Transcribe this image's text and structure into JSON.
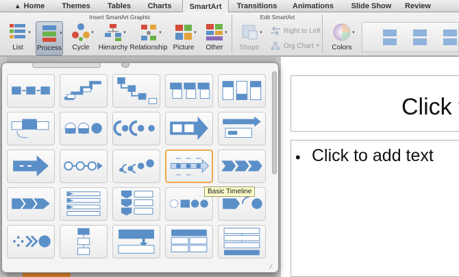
{
  "tabs": [
    {
      "label": "Home"
    },
    {
      "label": "Themes"
    },
    {
      "label": "Tables"
    },
    {
      "label": "Charts"
    },
    {
      "label": "SmartArt"
    },
    {
      "label": "Transitions"
    },
    {
      "label": "Animations"
    },
    {
      "label": "Slide Show"
    },
    {
      "label": "Review"
    }
  ],
  "active_tab": "SmartArt",
  "ribbon": {
    "insert_group_title": "Insert SmartArt Graphic",
    "edit_group_title": "Edit SmartArt",
    "buttons": {
      "list": "List",
      "process": "Process",
      "cycle": "Cycle",
      "hierarchy": "Hierarchy",
      "relationship": "Relationship",
      "picture": "Picture",
      "other": "Other",
      "shape": "Shape",
      "right_to_left": "Right to Left",
      "org_chart": "Org Chart",
      "colors": "Colors"
    }
  },
  "gallery": {
    "selected_category": "Process",
    "tooltip": "Basic Timeline",
    "highlighted_item": "Basic Timeline"
  },
  "slide": {
    "title_placeholder": "Click t",
    "body_placeholder": "Click to add text",
    "bullet": "•"
  },
  "colors": {
    "smartart_blue": "#5b8fc7",
    "highlight_orange": "#f0a64a",
    "tooltip_bg": "#ffffcc"
  }
}
